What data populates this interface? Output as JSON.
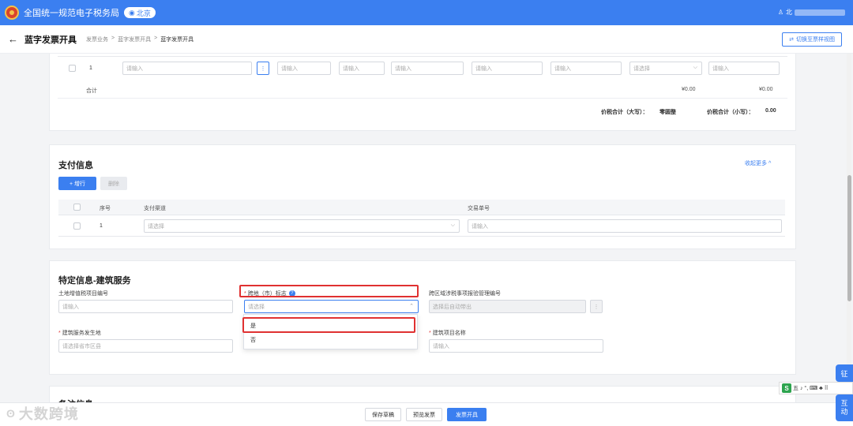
{
  "topbar": {
    "title": "全国统一规范电子税务局",
    "city": "北京",
    "user_prefix": "北"
  },
  "header": {
    "page_title": "蓝字发票开具",
    "breadcrumbs": [
      "发票业务",
      ">",
      "蓝字发票开具",
      ">",
      "蓝字发票开具"
    ],
    "switch_view_label": "切换至票样视图"
  },
  "goods_table": {
    "row_no": "1",
    "placeholder_input": "请输入",
    "placeholder_select": "请选择",
    "more_btn": "⋮",
    "total_label": "合计",
    "total_amount": "¥0.00",
    "total_tax": "¥0.00",
    "upper_total_label": "价税合计（大写）：",
    "upper_total_value": "零圆整",
    "lower_total_label": "价税合计（小写）：",
    "lower_total_value": "0.00"
  },
  "payment": {
    "title": "支付信息",
    "collapse_label": "收起更多 ^",
    "add_row_label": "+ 增行",
    "delete_label": "删除",
    "columns": [
      "序号",
      "支付渠道",
      "交易单号"
    ],
    "rows": [
      {
        "no": "1",
        "channel_placeholder": "请选择",
        "txn_placeholder": "请输入"
      }
    ]
  },
  "construction": {
    "title": "特定信息-建筑服务",
    "land_tax_no_label": "土地增值税项目编号",
    "land_tax_no_placeholder": "请输入",
    "cross_region_label": "跨地（市）标志",
    "cross_region_placeholder": "请选择",
    "cross_region_options": [
      "是",
      "否"
    ],
    "cross_tax_no_label": "跨区域涉税事项报验管理编号",
    "cross_tax_no_placeholder": "选择后自动带出",
    "location_label": "建筑服务发生地",
    "location_placeholder": "请选择省市区县",
    "project_name_label": "建筑项目名称",
    "project_name_placeholder": "请输入"
  },
  "remarks": {
    "title": "备注信息"
  },
  "footer": {
    "save_draft": "保存草稿",
    "preview": "预览发票",
    "issue": "发票开具"
  },
  "side": {
    "top_label": "征",
    "bottom_label_1": "互",
    "bottom_label_2": "动"
  },
  "ime": {
    "logo": "S",
    "text": "五 ♪ °, ⌨ ♣ ⠿"
  },
  "watermark": {
    "text": "大数跨境"
  },
  "colors": {
    "primary": "#3b7ff0",
    "highlight": "#e03131",
    "required": "#e23c3c"
  }
}
